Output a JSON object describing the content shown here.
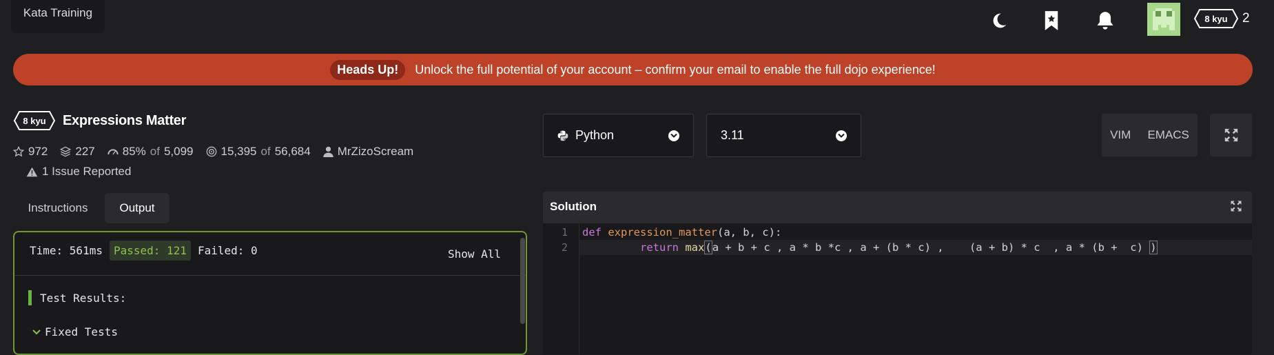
{
  "topbar": {
    "tab_label": "Kata Training",
    "rank": "8 kyu",
    "honor": "2",
    "icons": [
      "moon-icon",
      "bookmark-star-icon",
      "bell-icon",
      "avatar"
    ]
  },
  "banner": {
    "pill": "Heads Up!",
    "message": "Unlock the full potential of your account – confirm your email to enable the full dojo experience!"
  },
  "kata": {
    "rank": "8 kyu",
    "title": "Expressions Matter",
    "stars": "972",
    "collections": "227",
    "satisfaction": "85%",
    "satisfaction_of_label": "of",
    "satisfaction_votes": "5,099",
    "completed": "15,395",
    "completed_of_label": "of",
    "attempts": "56,684",
    "author": "MrZizoScream",
    "issues": "1 Issue Reported"
  },
  "tabs": {
    "instructions": "Instructions",
    "output": "Output"
  },
  "output": {
    "time": "Time: 561ms",
    "passed": "Passed: 121",
    "failed": "Failed: 0",
    "show_all": "Show All",
    "test_results": "Test Results:",
    "fixed_tests": "Fixed Tests"
  },
  "language": {
    "name": "Python",
    "version": "3.11"
  },
  "modes": {
    "vim": "VIM",
    "emacs": "EMACS"
  },
  "solution": {
    "title": "Solution",
    "line_numbers": [
      "1",
      "2"
    ],
    "line1": {
      "kw": "def",
      "fn": "expression_matter",
      "rest": "(a, b, c):"
    },
    "line2": {
      "indent": "         ",
      "kw": "return",
      "fn": "max",
      "open": "(",
      "body": "a + b + c , a * b *c , a + (b * c) ,    (a + b) * c  , a * (b +  c) ",
      "close": ")"
    }
  },
  "colors": {
    "banner": "#bd4228",
    "passed_green": "#8fc24a",
    "panel_border": "#6f9a2f",
    "background": "#1f1f21"
  }
}
